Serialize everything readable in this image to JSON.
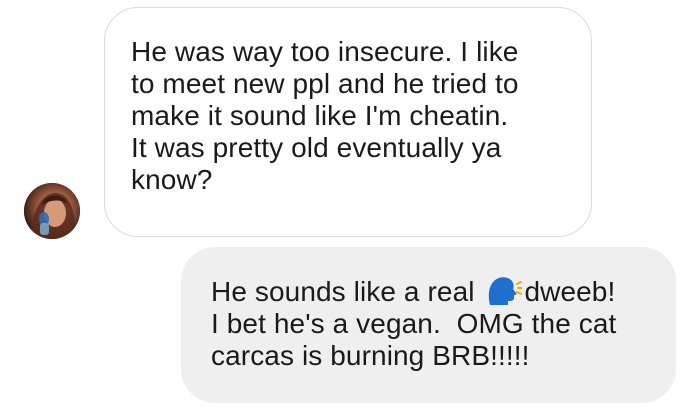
{
  "conversation": {
    "received_message": {
      "lines": [
        "He was way too insecure. I like",
        "to meet new ppl and he tried to",
        "make it sound like I'm cheatin.",
        "It was pretty old eventually ya",
        "know?"
      ]
    },
    "sent_message": {
      "line1_before_emoji": "He sounds like a real ",
      "emoji": "speaking-head-emoji",
      "line1_after_emoji": "dweeb!",
      "line2": "I bet he's a vegan.  OMG the cat",
      "line3": "carcas is burning BRB!!!!!"
    }
  },
  "colors": {
    "received_bubble_bg": "#ffffff",
    "received_bubble_border": "#d9d9d9",
    "sent_bubble_bg": "#efefef",
    "text": "#1a1a1a",
    "emoji_head": "#1f6fd1"
  }
}
